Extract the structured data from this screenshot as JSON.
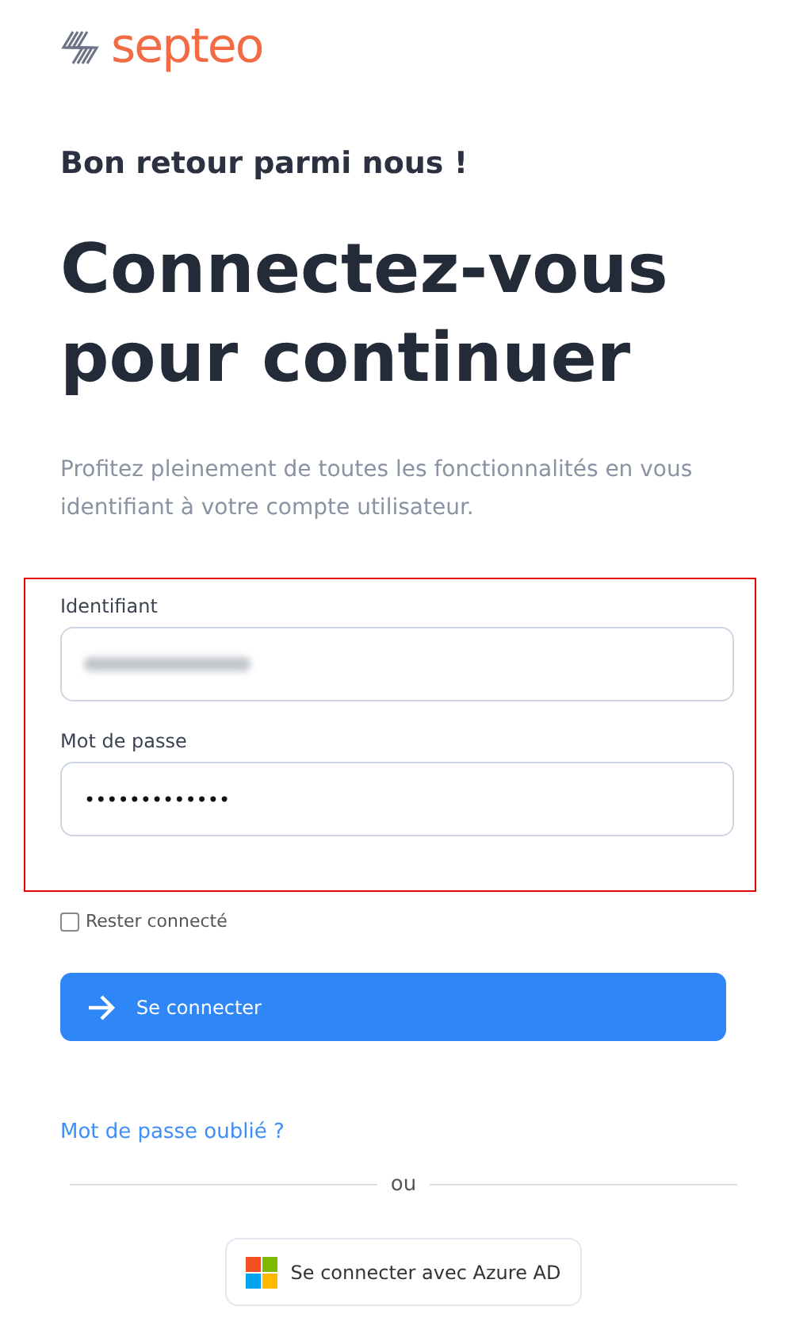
{
  "logo": {
    "text": "septeo"
  },
  "greeting": "Bon retour parmi nous !",
  "title": "Connectez-vous pour continuer",
  "intro": "Profitez pleinement de toutes les fonctionnalités en vous identifiant à votre compte utilisateur.",
  "form": {
    "highlighted": true,
    "fields": [
      {
        "label": "Identifiant",
        "kind": "redacted"
      },
      {
        "label": "Mot de passe",
        "kind": "password",
        "value": "•••••••••••••"
      }
    ]
  },
  "remember": {
    "label": "Rester connecté",
    "checked": false
  },
  "submit": {
    "label": "Se connecter"
  },
  "forgot": "Mot de passe oublié ?",
  "separator": "ou",
  "sso": {
    "label": "Se connecter avec Azure AD"
  }
}
